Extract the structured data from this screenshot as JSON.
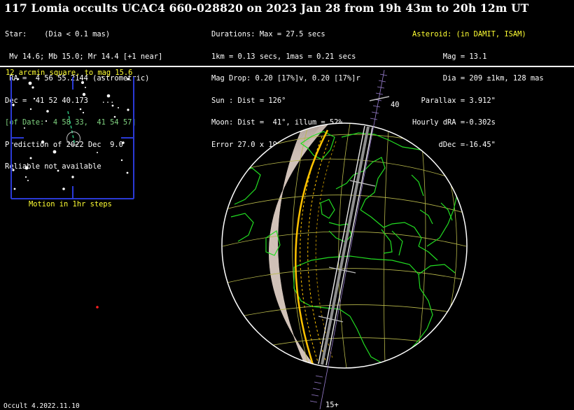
{
  "header": {
    "title": "117 Lomia occults UCAC4 660-028820 on 2023 Jan 28 from 19h 43m to 20h 12m UT"
  },
  "star": {
    "line1": "Star:    (Dia < 0.1 mas)",
    "line2": " Mv 14.6; Mb 15.0; Mr 14.4 [+1 near]",
    "line3": " RA =  4 56 55.2144 (astrometric)",
    "line4": "Dec =  41 52 40.173   ...",
    "line5": "[of Date:  4 58 33,  41 54 57]",
    "line6": "Prediction of 2022 Dec  9.0",
    "line7": "Reliable not available"
  },
  "event": {
    "line1": "Durations: Max = 27.5 secs",
    "line2": "1km = 0.13 secs, 1mas = 0.21 secs",
    "line3": "Mag Drop: 0.20 [17%]v, 0.20 [17%]r",
    "line4": "Sun : Dist = 126°",
    "line5": "Moon: Dist =  41°, illum = 52%",
    "line6": "Error 27.0 x 19.0 mas in PA 81°"
  },
  "asteroid": {
    "line1": "Asteroid: (in DAMIT, ISAM)",
    "line2": "       Mag = 13.1",
    "line3": "       Dia = 209 ±1km, 128 mas",
    "line4": "  Parallax = 3.912\"",
    "line5": "Hourly dRA =-0.302s",
    "line6": "      dDec =-16.45\""
  },
  "finder": {
    "title": "12 arcmin square, to mag 15.6",
    "motion_label": "Motion in 1hr steps"
  },
  "path_labels": {
    "top": "40",
    "bottom": "15+"
  },
  "footer": {
    "version": "Occult 4.2022.11.10"
  },
  "colors": {
    "background": "#000000",
    "heading_highlight": "#ffff33",
    "of_date_text": "#7fd27f",
    "coastline": "#22dd22",
    "grid": "#b7b74a",
    "finder_frame": "#2a3ad6",
    "shadow_path": "#d8d8d8",
    "path_ticks": "#9a7fd0",
    "sunset_line": "#ffc300"
  }
}
